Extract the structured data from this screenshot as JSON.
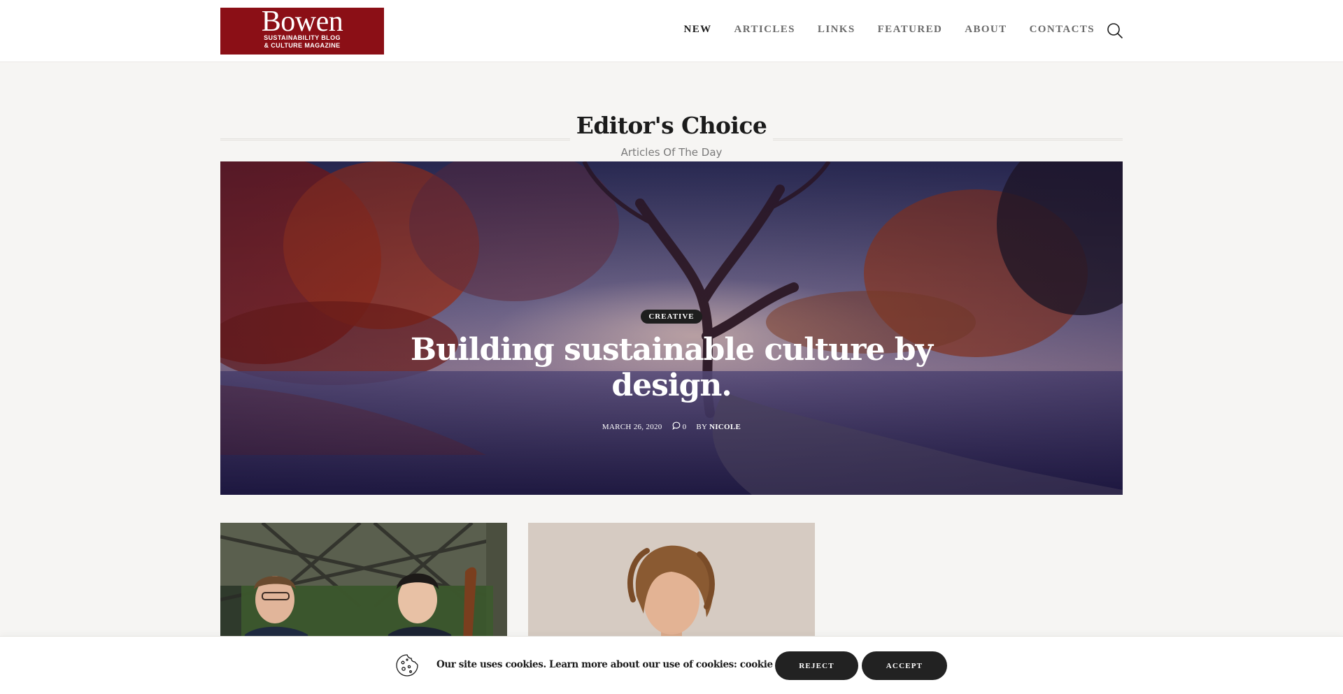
{
  "header": {
    "logo": {
      "word": "Bowen",
      "line1": "SUSTAINABILITY BLOG",
      "line2": "& CULTURE MAGAZINE",
      "color": "#8b0f16"
    },
    "nav": [
      {
        "label": "NEW",
        "active": true
      },
      {
        "label": "ARTICLES",
        "active": false
      },
      {
        "label": "LINKS",
        "active": false
      },
      {
        "label": "FEATURED",
        "active": false
      },
      {
        "label": "ABOUT",
        "active": false
      },
      {
        "label": "CONTACTS",
        "active": false
      }
    ],
    "search_icon": "search-icon"
  },
  "section": {
    "title": "Editor's Choice",
    "subtitle": "Articles Of The Day"
  },
  "hero": {
    "category": "CREATIVE",
    "title": "Building sustainable culture by design.",
    "date": "MARCH 26, 2020",
    "comments": "0",
    "by": "BY",
    "author": "NICOLE",
    "comment_icon": "comment-icon"
  },
  "cards": [
    {
      "image": "two-musicians-photo"
    },
    {
      "image": "curly-haired-man-photo"
    }
  ],
  "cookie": {
    "icon": "cookie-icon",
    "text": "Our site uses cookies. Learn more about our use of cookies: cookie policy",
    "reject": "REJECT",
    "accept": "ACCEPT"
  }
}
